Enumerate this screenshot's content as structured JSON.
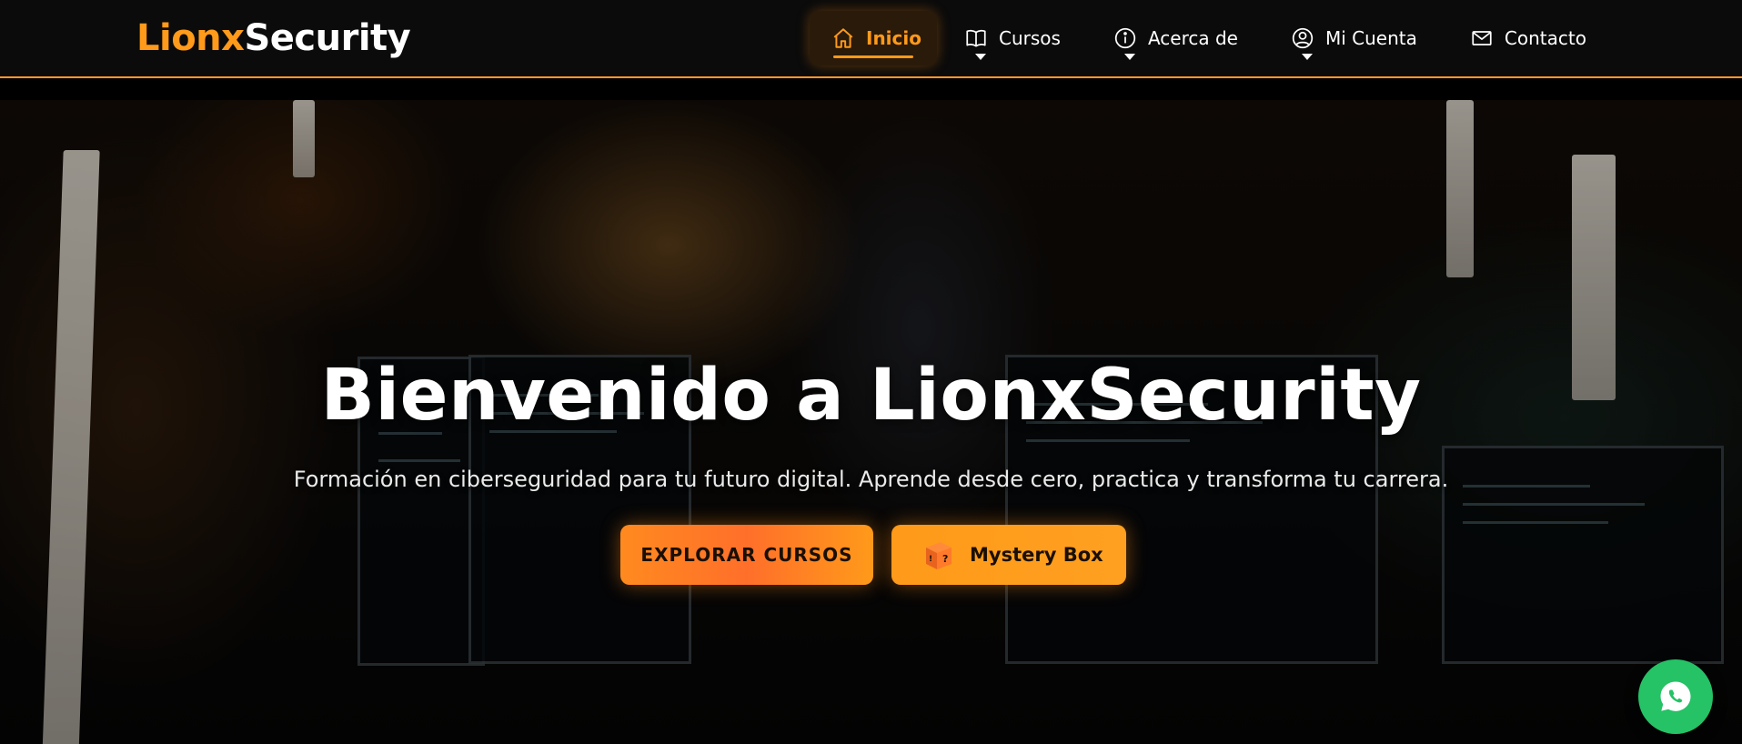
{
  "brand": {
    "accent": "Lionx",
    "rest": "Security",
    "accent_color": "#ff9a1a"
  },
  "nav": {
    "items": [
      {
        "label": "Inicio",
        "icon": "home-icon",
        "active": true
      },
      {
        "label": "Cursos",
        "icon": "book-icon",
        "dropdown": true
      },
      {
        "label": "Acerca de",
        "icon": "info-icon",
        "dropdown": true
      },
      {
        "label": "Mi Cuenta",
        "icon": "user-icon",
        "dropdown": true
      },
      {
        "label": "Contacto",
        "icon": "envelope-icon"
      }
    ]
  },
  "hero": {
    "title": "Bienvenido a LionxSecurity",
    "subtitle": "Formación en ciberseguridad para tu futuro digital. Aprende desde cero, practica y transforma tu carrera.",
    "primary_button": "EXPLORAR CURSOS",
    "secondary_button": "Mystery Box",
    "secondary_icon": "mystery-box-icon"
  },
  "floating": {
    "icon": "whatsapp-icon",
    "color": "#25c266"
  }
}
